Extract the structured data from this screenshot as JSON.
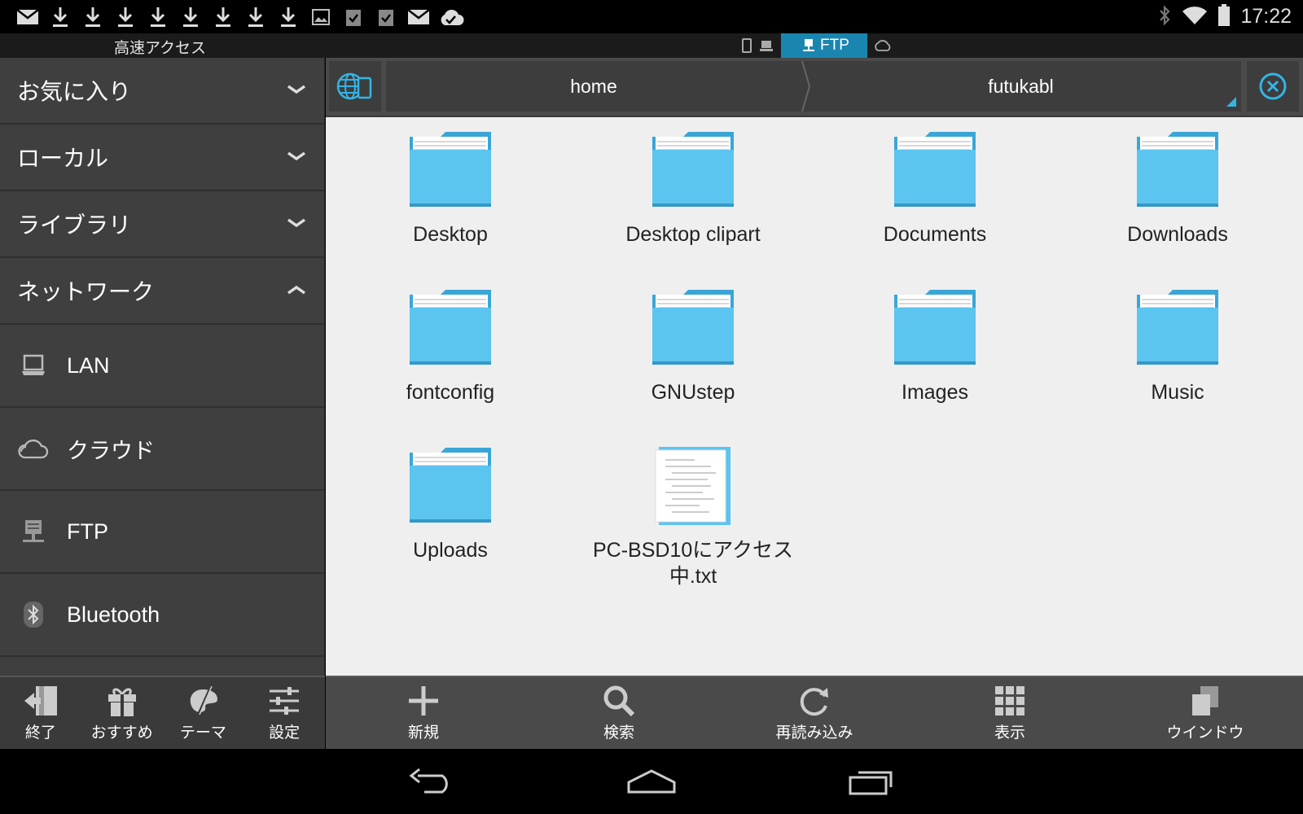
{
  "status_bar": {
    "time": "17:22",
    "notification_icons": [
      "mail-icon",
      "download-icon",
      "download-icon",
      "download-icon",
      "download-icon",
      "download-icon",
      "download-icon",
      "download-icon",
      "download-icon",
      "image-icon",
      "clipboard-check-icon",
      "clipboard-check-icon",
      "mail-icon",
      "cloud-check-icon"
    ],
    "system_icons": [
      "bluetooth-icon",
      "wifi-icon",
      "battery-icon"
    ]
  },
  "top_strip": {
    "quick_access": "高速アクセス",
    "active_window_label": "FTP"
  },
  "sidebar": {
    "sections": [
      {
        "label": "お気に入り",
        "expanded": false
      },
      {
        "label": "ローカル",
        "expanded": false
      },
      {
        "label": "ライブラリ",
        "expanded": false
      },
      {
        "label": "ネットワーク",
        "expanded": true
      }
    ],
    "network_items": [
      {
        "label": "LAN",
        "icon": "laptop-icon"
      },
      {
        "label": "クラウド",
        "icon": "cloud-icon"
      },
      {
        "label": "FTP",
        "icon": "ftp-server-icon"
      },
      {
        "label": "Bluetooth",
        "icon": "bluetooth-icon"
      }
    ]
  },
  "path_bar": {
    "crumbs": [
      "home",
      "futukabl"
    ]
  },
  "files": [
    {
      "name": "Desktop",
      "type": "folder"
    },
    {
      "name": "Desktop clipart",
      "type": "folder"
    },
    {
      "name": "Documents",
      "type": "folder"
    },
    {
      "name": "Downloads",
      "type": "folder"
    },
    {
      "name": "fontconfig",
      "type": "folder"
    },
    {
      "name": "GNUstep",
      "type": "folder"
    },
    {
      "name": "Images",
      "type": "folder"
    },
    {
      "name": "Music",
      "type": "folder"
    },
    {
      "name": "Uploads",
      "type": "folder"
    },
    {
      "name": "PC-BSD10にアクセス中.txt",
      "name_line1": "PC-BSD10にアクセス",
      "name_line2": "中.txt",
      "type": "text-file"
    }
  ],
  "left_toolbar": [
    {
      "label": "終了",
      "icon": "exit-icon"
    },
    {
      "label": "おすすめ",
      "icon": "gift-icon"
    },
    {
      "label": "テーマ",
      "icon": "palette-icon"
    },
    {
      "label": "設定",
      "icon": "sliders-icon"
    }
  ],
  "main_toolbar": [
    {
      "label": "新規",
      "icon": "plus-icon"
    },
    {
      "label": "検索",
      "icon": "search-icon"
    },
    {
      "label": "再読み込み",
      "icon": "refresh-icon"
    },
    {
      "label": "表示",
      "icon": "grid-icon"
    },
    {
      "label": "ウインドウ",
      "icon": "windows-icon"
    }
  ],
  "colors": {
    "accent": "#1a86b0",
    "folder": "#5bc4ef",
    "sidebar_bg": "#3f3f3f",
    "content_bg": "#efefef"
  }
}
